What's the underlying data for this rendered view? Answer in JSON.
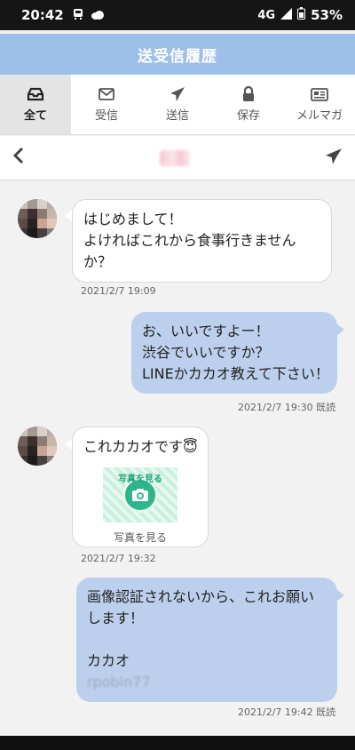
{
  "status_bar": {
    "time": "20:42",
    "network": "4G",
    "battery": "53%"
  },
  "header": {
    "title": "送受信履歴"
  },
  "tabs": [
    {
      "label": "全て",
      "icon": "inbox-icon",
      "active": true
    },
    {
      "label": "受信",
      "icon": "envelope-icon",
      "active": false
    },
    {
      "label": "送信",
      "icon": "paper-plane-icon",
      "active": false
    },
    {
      "label": "保存",
      "icon": "lock-icon",
      "active": false
    },
    {
      "label": "メルマガ",
      "icon": "newspaper-icon",
      "active": false
    }
  ],
  "conversation_bar": {
    "back_icon": "chevron-left-icon",
    "send_icon": "paper-plane-icon"
  },
  "messages": [
    {
      "direction": "incoming",
      "lines": [
        "はじめまして！",
        "よければこれから食事行きません",
        "か？"
      ],
      "timestamp": "2021/2/7 19:09"
    },
    {
      "direction": "outgoing",
      "lines": [
        "お、いいですよー！",
        "渋谷でいいですか？",
        "LINEかカカオ教えて下さい！"
      ],
      "timestamp": "2021/2/7 19:30 既読"
    },
    {
      "direction": "incoming",
      "lines": [
        "これカカオです😇"
      ],
      "attachment": {
        "overlay_text": "写真を見る",
        "label": "写真を見る"
      },
      "timestamp": "2021/2/7 19:32"
    },
    {
      "direction": "outgoing",
      "lines": [
        "画像認証されないから、これお願い",
        "します！",
        "",
        "カカオ"
      ],
      "blurred_id": "rpobln77",
      "timestamp": "2021/2/7 19:42 既読"
    }
  ],
  "colors": {
    "header_bg": "#9dbfea",
    "outgoing_bubble": "#bcd0ee",
    "incoming_bubble": "#ffffff",
    "background": "#f2f2f2"
  }
}
